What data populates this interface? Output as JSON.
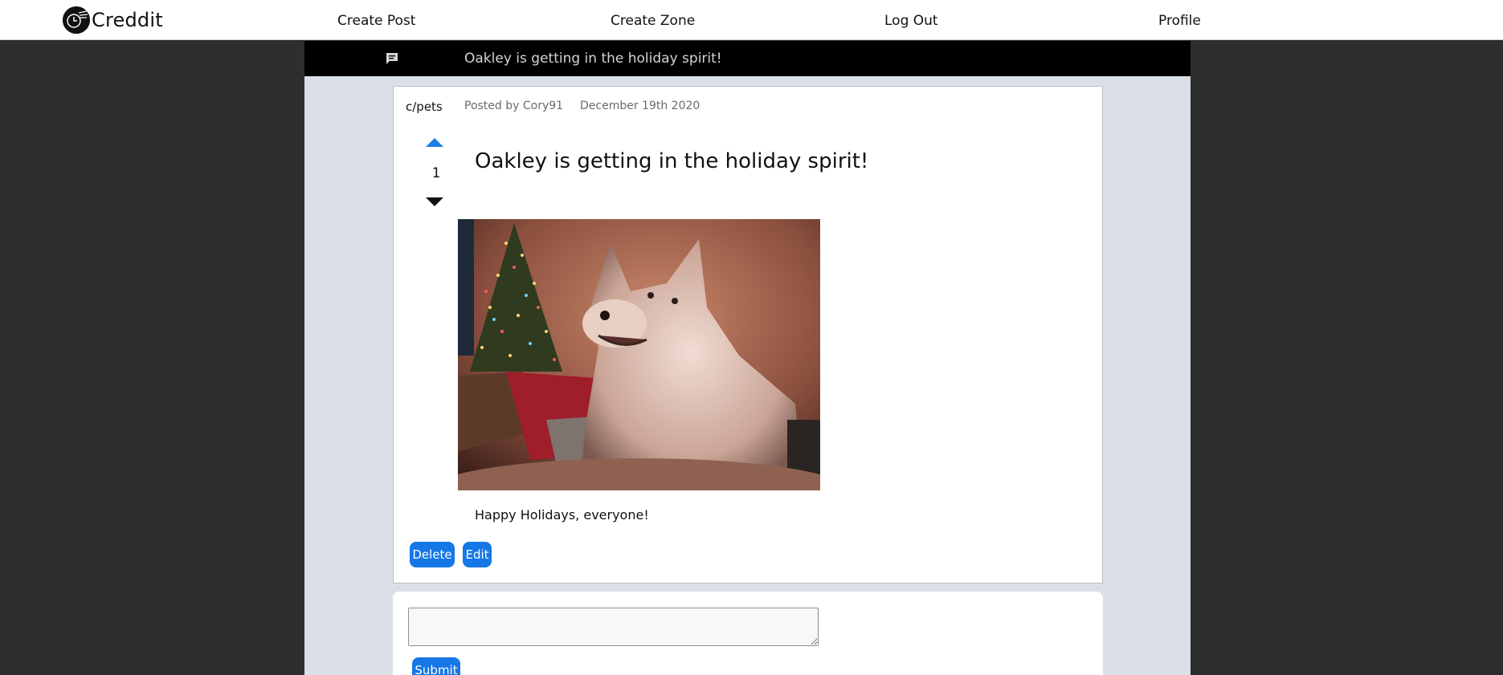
{
  "app": {
    "name": "Creddit"
  },
  "nav": {
    "create_post": "Create Post",
    "create_zone": "Create Zone",
    "log_out": "Log Out",
    "profile": "Profile"
  },
  "banner": {
    "title": "Oakley is getting in the holiday spirit!",
    "icon": "comment-icon"
  },
  "post": {
    "zone": "c/pets",
    "author": "Posted by Cory91",
    "date": "December 19th 2020",
    "votes": "1",
    "title": "Oakley is getting in the holiday spirit!",
    "body": "Happy Holidays, everyone!",
    "delete_label": "Delete",
    "edit_label": "Edit"
  },
  "comment": {
    "value": "",
    "submit_label": "Submit"
  },
  "colors": {
    "accent": "#1677e6",
    "page_bg": "#2d2f2e",
    "column_bg": "#dbe0e8",
    "banner_bg": "#000000"
  }
}
